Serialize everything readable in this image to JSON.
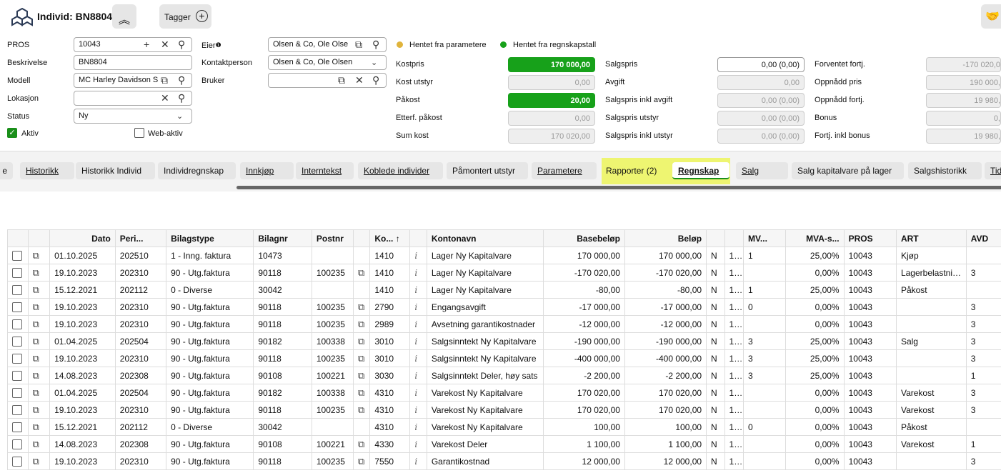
{
  "header": {
    "title": "Individ: BN8804",
    "tagger_label": "Tagger"
  },
  "form": {
    "pros_label": "PROS",
    "pros_value": "10043",
    "beskrivelse_label": "Beskrivelse",
    "beskrivelse_value": "BN8804",
    "modell_label": "Modell",
    "modell_value": "MC Harley Davidson S",
    "lokasjon_label": "Lokasjon",
    "lokasjon_value": "",
    "status_label": "Status",
    "status_value": "Ny",
    "aktiv_label": "Aktiv",
    "webaktiv_label": "Web-aktiv",
    "eier_label": "Eier",
    "eier_value": "Olsen  & Co, Ole Olse",
    "kontakt_label": "Kontaktperson",
    "kontakt_value": "Olsen & Co, Ole Olsen",
    "bruker_label": "Bruker",
    "bruker_value": ""
  },
  "legend": {
    "param": "Hentet fra parametere",
    "regn": "Hentet fra regnskapstall",
    "param_color": "#e0b43c",
    "regn_color": "#17a11a"
  },
  "costs": {
    "kostpris_label": "Kostpris",
    "kostpris": "170 000,00",
    "kostutstyr_label": "Kost utstyr",
    "kostutstyr": "0,00",
    "pakost_label": "Påkost",
    "pakost": "20,00",
    "etterf_label": "Etterf. påkost",
    "etterf": "0,00",
    "sumkost_label": "Sum kost",
    "sumkost": "170 020,00"
  },
  "sales": {
    "salgspris_label": "Salgspris",
    "salgspris": "0,00 (0,00)",
    "avgift_label": "Avgift",
    "avgift": "0,00",
    "inklavg_label": "Salgspris inkl avgift",
    "inklavg": "0,00 (0,00)",
    "utstyr_label": "Salgspris utstyr",
    "utstyr": "0,00 (0,00)",
    "inklutstyr_label": "Salgspris inkl utstyr",
    "inklutstyr": "0,00 (0,00)"
  },
  "fortj": {
    "forventet_label": "Forventet fortj.",
    "forventet": "-170 020,0",
    "oppnaddpris_label": "Oppnådd pris",
    "oppnaddpris": "190 000,",
    "oppnaddfortj_label": "Oppnådd fortj.",
    "oppnaddfortj": "19 980,",
    "bonus_label": "Bonus",
    "bonus": "0,",
    "inklbonus_label": "Fortj. inkl bonus",
    "inklbonus": "19 980,"
  },
  "tabs": [
    "e",
    "Historikk",
    "Historikk Individ",
    "Individregnskap",
    "Innkjøp",
    "Interntekst",
    "Koblede individer",
    "Påmontert utstyr",
    "Parametere",
    "Rapporter (2)",
    "Regnskap",
    "Salg",
    "Salg kapitalvare på lager",
    "Salgshistorikk",
    "Tid"
  ],
  "grid": {
    "headers": [
      "",
      "",
      "Dato",
      "Peri...",
      "Bilagstype",
      "Bilagnr",
      "Postnr",
      "",
      "Ko...  ↑",
      "",
      "Kontonavn",
      "Basebeløp",
      "Beløp",
      "",
      "",
      "MV...",
      "MVA-s...",
      "PROS",
      "ART",
      "AVD"
    ],
    "rows": [
      [
        "01.10.2025",
        "202510",
        "1 - Inng. faktura",
        "10473",
        "",
        "1410",
        "Lager Ny Kapitalvare",
        "170 000,00",
        "170 000,00",
        "N",
        "1...",
        "1",
        "25,00%",
        "10043",
        "Kjøp",
        ""
      ],
      [
        "19.10.2023",
        "202310",
        "90 - Utg.faktura",
        "90118",
        "100235",
        "1410",
        "Lager Ny Kapitalvare",
        "-170 020,00",
        "-170 020,00",
        "N",
        "1...",
        "",
        "0,00%",
        "10043",
        "Lagerbelastning",
        "3"
      ],
      [
        "15.12.2021",
        "202112",
        "0 - Diverse",
        "30042",
        "",
        "1410",
        "Lager Ny Kapitalvare",
        "-80,00",
        "-80,00",
        "N",
        "1...",
        "1",
        "25,00%",
        "10043",
        "Påkost",
        ""
      ],
      [
        "19.10.2023",
        "202310",
        "90 - Utg.faktura",
        "90118",
        "100235",
        "2790",
        "Engangsavgift",
        "-17 000,00",
        "-17 000,00",
        "N",
        "1...",
        "0",
        "0,00%",
        "10043",
        "",
        "3"
      ],
      [
        "19.10.2023",
        "202310",
        "90 - Utg.faktura",
        "90118",
        "100235",
        "2989",
        "Avsetning garantikostnader",
        "-12 000,00",
        "-12 000,00",
        "N",
        "1...",
        "",
        "0,00%",
        "10043",
        "",
        "3"
      ],
      [
        "01.04.2025",
        "202504",
        "90 - Utg.faktura",
        "90182",
        "100338",
        "3010",
        "Salgsinntekt Ny Kapitalvare",
        "-190 000,00",
        "-190 000,00",
        "N",
        "1...",
        "3",
        "25,00%",
        "10043",
        "Salg",
        "3"
      ],
      [
        "19.10.2023",
        "202310",
        "90 - Utg.faktura",
        "90118",
        "100235",
        "3010",
        "Salgsinntekt Ny Kapitalvare",
        "-400 000,00",
        "-400 000,00",
        "N",
        "1...",
        "3",
        "25,00%",
        "10043",
        "",
        "3"
      ],
      [
        "14.08.2023",
        "202308",
        "90 - Utg.faktura",
        "90108",
        "100221",
        "3030",
        "Salgsinntekt Deler, høy sats",
        "-2 200,00",
        "-2 200,00",
        "N",
        "1...",
        "3",
        "25,00%",
        "10043",
        "",
        "1"
      ],
      [
        "01.04.2025",
        "202504",
        "90 - Utg.faktura",
        "90182",
        "100338",
        "4310",
        "Varekost Ny Kapitalvare",
        "170 020,00",
        "170 020,00",
        "N",
        "1...",
        "",
        "0,00%",
        "10043",
        "Varekost",
        "3"
      ],
      [
        "19.10.2023",
        "202310",
        "90 - Utg.faktura",
        "90118",
        "100235",
        "4310",
        "Varekost Ny Kapitalvare",
        "170 020,00",
        "170 020,00",
        "N",
        "1...",
        "",
        "0,00%",
        "10043",
        "Varekost",
        "3"
      ],
      [
        "15.12.2021",
        "202112",
        "0 - Diverse",
        "30042",
        "",
        "4310",
        "Varekost Ny Kapitalvare",
        "100,00",
        "100,00",
        "N",
        "1...",
        "0",
        "0,00%",
        "10043",
        "Påkost",
        ""
      ],
      [
        "14.08.2023",
        "202308",
        "90 - Utg.faktura",
        "90108",
        "100221",
        "4330",
        "Varekost Deler",
        "1 100,00",
        "1 100,00",
        "N",
        "1...",
        "",
        "0,00%",
        "10043",
        "Varekost",
        "1"
      ],
      [
        "19.10.2023",
        "202310",
        "90 - Utg.faktura",
        "90118",
        "100235",
        "7550",
        "Garantikostnad",
        "12 000,00",
        "12 000,00",
        "N",
        "1...",
        "",
        "0,00%",
        "10043",
        "",
        "3"
      ]
    ]
  }
}
